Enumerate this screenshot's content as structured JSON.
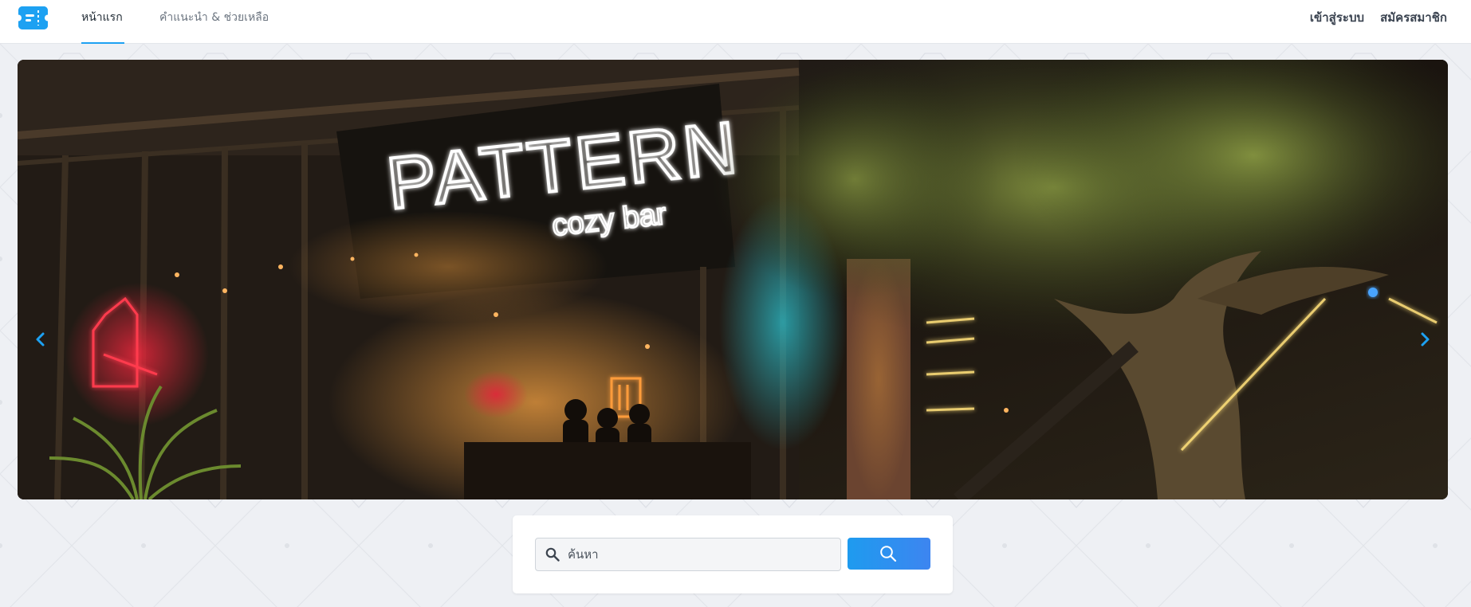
{
  "header": {
    "logo_icon": "ticket-logo-icon",
    "tabs": [
      {
        "label": "หน้าแรก",
        "active": true
      },
      {
        "label": "คำแนะนำ & ช่วยเหลือ",
        "active": false
      }
    ],
    "login_label": "เข้าสู่ระบบ",
    "register_label": "สมัครสมาชิก"
  },
  "hero": {
    "sign_line1": "PATTERN",
    "sign_line2": "cozy bar",
    "prev_icon": "chevron-left-icon",
    "next_icon": "chevron-right-icon"
  },
  "search": {
    "placeholder": "ค้นหา",
    "value": "",
    "button_icon": "search-icon"
  },
  "colors": {
    "accent": "#1da1f2",
    "header_bg": "#ffffff",
    "page_bg": "#eef0f4"
  }
}
